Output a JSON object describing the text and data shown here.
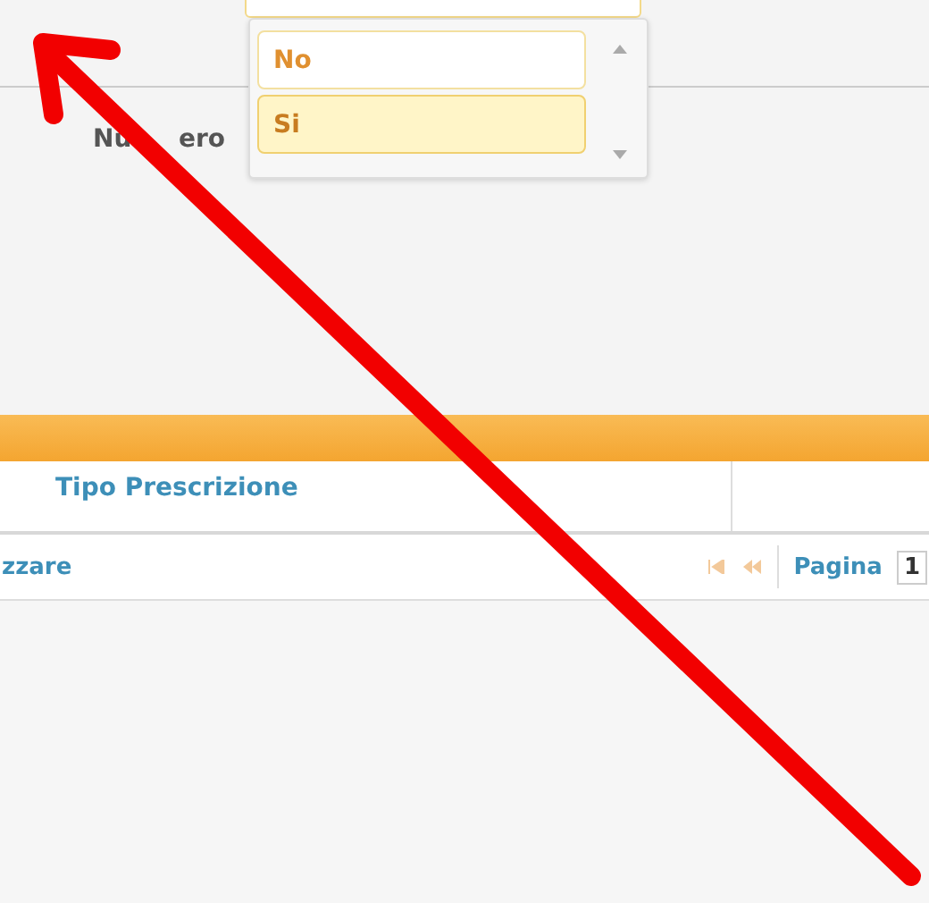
{
  "form": {
    "numero_label_parts": [
      "Nu",
      "ero"
    ],
    "dropdown": {
      "options": [
        {
          "label": "No",
          "selected": false
        },
        {
          "label": "Si",
          "selected": true
        }
      ]
    }
  },
  "grid": {
    "columns": [
      {
        "label": "Tipo Prescrizione"
      }
    ],
    "pager": {
      "message": "zzare",
      "page_label": "Pagina",
      "page_value": "1"
    }
  }
}
